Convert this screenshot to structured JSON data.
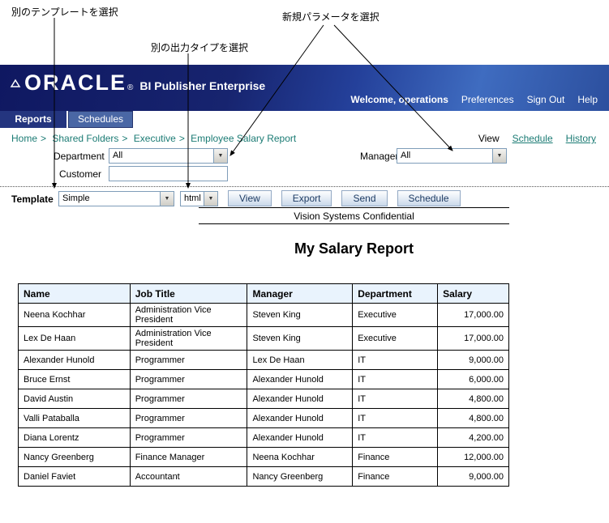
{
  "annotations": {
    "select_template": "別のテンプレートを選択",
    "select_output": "別の出力タイプを選択",
    "select_parameters": "新規パラメータを選択"
  },
  "header": {
    "logo": "ORACLE",
    "logo_mark": "®",
    "product": "BI Publisher Enterprise",
    "welcome": "Welcome, operations",
    "links": [
      "Preferences",
      "Sign Out",
      "Help"
    ]
  },
  "tabs": [
    {
      "label": "Reports",
      "active": true
    },
    {
      "label": "Schedules",
      "active": false
    }
  ],
  "breadcrumb": {
    "items": [
      "Home",
      "Shared Folders",
      "Executive",
      "Employee Salary Report"
    ],
    "separator": ">",
    "view_label": "View",
    "actions": [
      "Schedule",
      "History"
    ]
  },
  "parameters": {
    "department": {
      "label": "Department",
      "value": "All"
    },
    "manager": {
      "label": "Manager",
      "value": "All"
    },
    "customer": {
      "label": "Customer",
      "value": ""
    }
  },
  "toolbar": {
    "template_label": "Template",
    "template_value": "Simple",
    "output_value": "html",
    "buttons": [
      "View",
      "Export",
      "Send",
      "Schedule"
    ]
  },
  "report": {
    "confidential": "Vision Systems Confidential",
    "title": "My Salary Report",
    "table": {
      "headers": [
        "Name",
        "Job Title",
        "Manager",
        "Department",
        "Salary"
      ],
      "rows": [
        [
          "Neena Kochhar",
          "Administration Vice President",
          "Steven King",
          "Executive",
          "17,000.00"
        ],
        [
          "Lex De Haan",
          "Administration Vice President",
          "Steven King",
          "Executive",
          "17,000.00"
        ],
        [
          "Alexander Hunold",
          "Programmer",
          "Lex De Haan",
          "IT",
          "9,000.00"
        ],
        [
          "Bruce Ernst",
          "Programmer",
          "Alexander Hunold",
          "IT",
          "6,000.00"
        ],
        [
          "David Austin",
          "Programmer",
          "Alexander Hunold",
          "IT",
          "4,800.00"
        ],
        [
          "Valli Pataballa",
          "Programmer",
          "Alexander Hunold",
          "IT",
          "4,800.00"
        ],
        [
          "Diana Lorentz",
          "Programmer",
          "Alexander Hunold",
          "IT",
          "4,200.00"
        ],
        [
          "Nancy Greenberg",
          "Finance Manager",
          "Neena Kochhar",
          "Finance",
          "12,000.00"
        ],
        [
          "Daniel Faviet",
          "Accountant",
          "Nancy Greenberg",
          "Finance",
          "9,000.00"
        ]
      ]
    }
  },
  "colors": {
    "banner_start": "#0f1861",
    "banner_end": "#3f6cc0",
    "link": "#1b7b74",
    "table_header_bg": "#e9f3fd",
    "tab_active": "#24357f",
    "tab_inactive": "#4a67a5",
    "button_text": "#1e3c64"
  }
}
